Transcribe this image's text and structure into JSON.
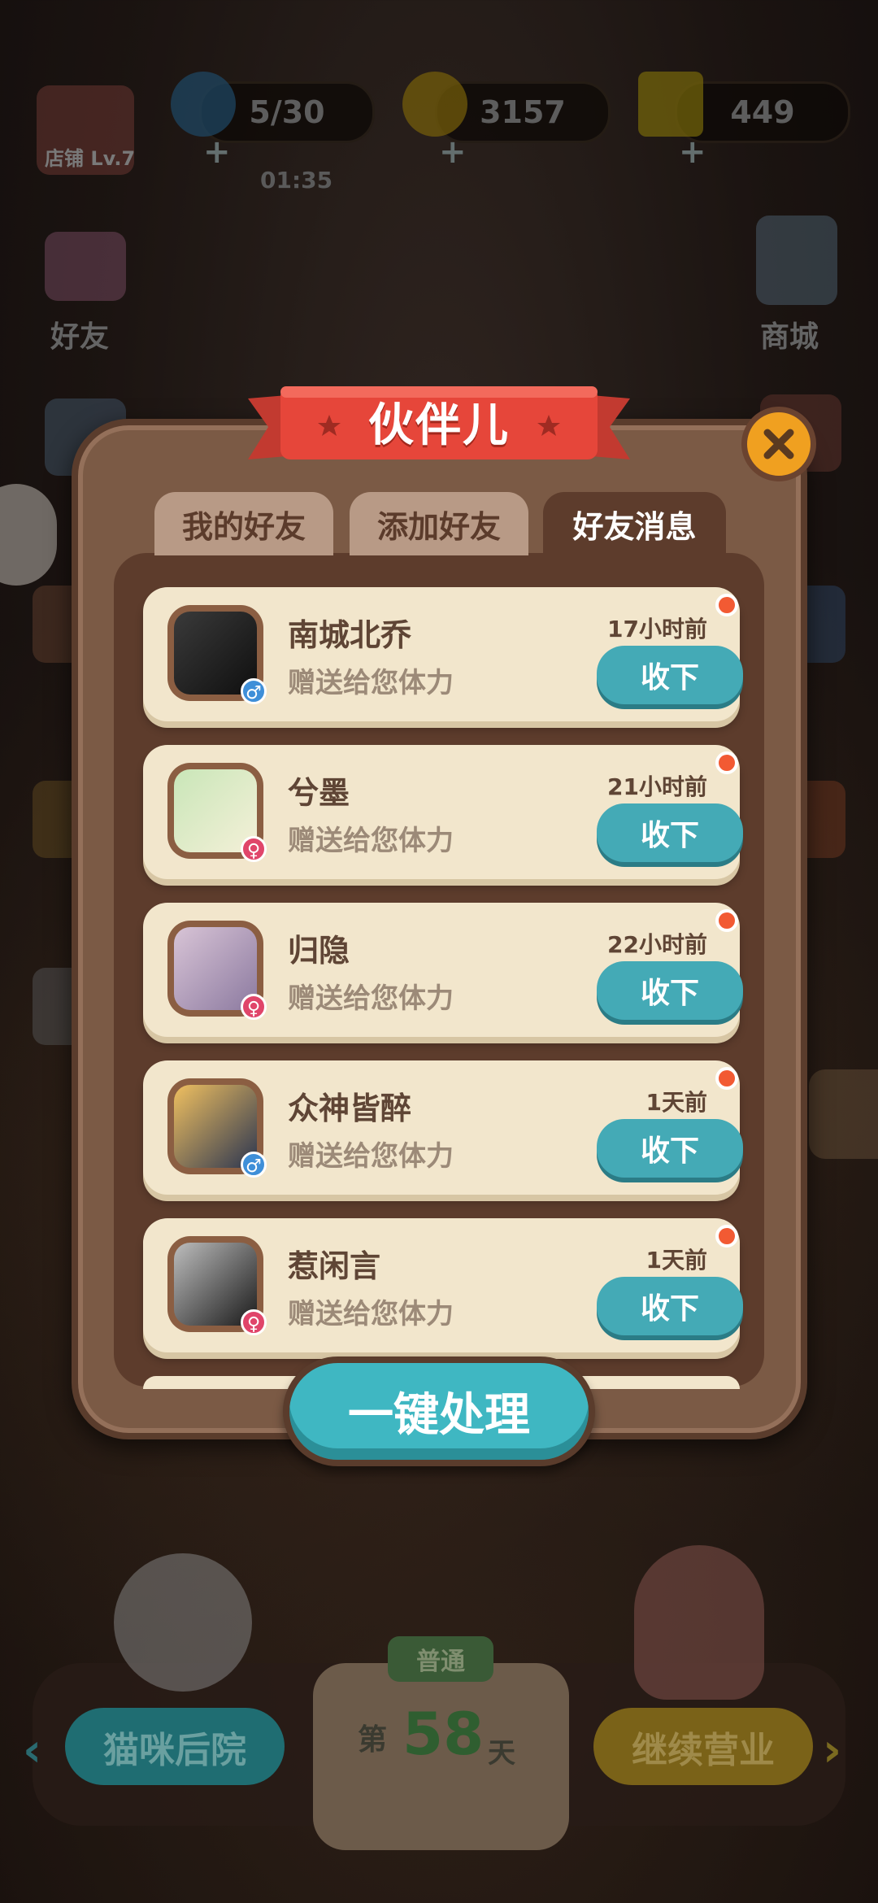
{
  "hud": {
    "shop_label": "店铺 Lv.7",
    "energy": "5/30",
    "energy_timer": "01:35",
    "coins": "3157",
    "stars": "449"
  },
  "side": {
    "friends": "好友",
    "mall": "商城"
  },
  "panel": {
    "title": "伙伴儿",
    "tabs": [
      "我的好友",
      "添加好友",
      "好友消息"
    ],
    "active_tab": 2,
    "messages": [
      {
        "name": "南城北乔",
        "text": "赠送给您体力",
        "time": "17小时前",
        "gender": "male",
        "button": "收下"
      },
      {
        "name": "兮墨",
        "text": "赠送给您体力",
        "time": "21小时前",
        "gender": "female",
        "button": "收下"
      },
      {
        "name": "归隐",
        "text": "赠送给您体力",
        "time": "22小时前",
        "gender": "female",
        "button": "收下"
      },
      {
        "name": "众神皆醉",
        "text": "赠送给您体力",
        "time": "1天前",
        "gender": "male",
        "button": "收下"
      },
      {
        "name": "惹闲言",
        "text": "赠送给您体力",
        "time": "1天前",
        "gender": "female",
        "button": "收下"
      }
    ],
    "bulk_button": "一键处理"
  },
  "bottom": {
    "left_button": "猫咪后院",
    "mode_badge": "普通",
    "day_prefix": "第",
    "day_number": "58",
    "day_suffix": "天",
    "right_button": "继续营业"
  },
  "colors": {
    "accent_teal": "#44aab6",
    "ribbon_red": "#e6463a",
    "dot_orange": "#f25a33",
    "panel_brown": "#7b5a45"
  }
}
